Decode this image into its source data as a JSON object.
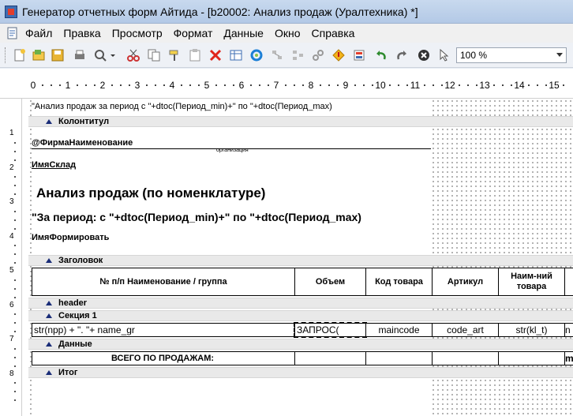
{
  "window": {
    "title": "Генератор отчетных форм Айтида - [b20002: Анализ продаж (Уралтехника) *]"
  },
  "menu": {
    "items": [
      "Файл",
      "Правка",
      "Просмотр",
      "Формат",
      "Данные",
      "Окно",
      "Справка"
    ]
  },
  "toolbar": {
    "zoom_value": "100 %"
  },
  "ruler": {
    "h_labels": [
      "0",
      "1",
      "2",
      "3",
      "4",
      "5",
      "6",
      "7",
      "8",
      "9",
      "10",
      "11",
      "12",
      "13",
      "14",
      "15"
    ],
    "v_labels": [
      "1",
      "2",
      "3",
      "4",
      "5",
      "6",
      "7",
      "8"
    ]
  },
  "report": {
    "header_formula": "\"Анализ продаж за период с \"+dtoc(Период_min)+\" по \"+dtoc(Период_max)",
    "band_kolontitul": "Колонтитул",
    "firm_name": "@ФирмаНаименование",
    "org_caption": "организация",
    "warehouse": "ИмяСклад",
    "main_title": "Анализ продаж (по номенклатуре)",
    "period_formula": "\"За период: с \"+dtoc(Период_min)+\" по \"+dtoc(Период_max)",
    "formed_by": "ИмяФормировать",
    "band_zagolovok": "Заголовок",
    "columns": [
      "№ п/п   Наименование / группа",
      "Объем",
      "Код товара",
      "Артикул",
      "Наим-ний товара"
    ],
    "band_header": "header",
    "band_section": "Секция 1",
    "row_section": [
      "str(npp) + \".  \"+ name_gr",
      "ЗАПРОС(",
      "maincode",
      "code_art",
      "str(kl_t)",
      "n"
    ],
    "band_data": "Данные",
    "total_label": "ВСЕГО ПО ПРОДАЖАМ:",
    "total_extra": "m",
    "band_itog": "Итог"
  }
}
